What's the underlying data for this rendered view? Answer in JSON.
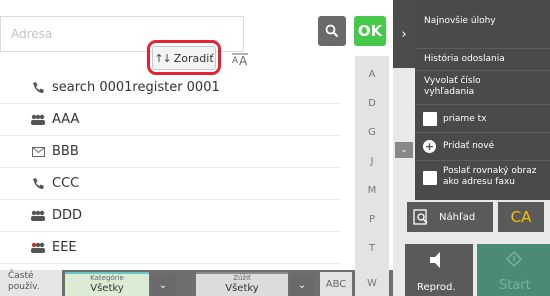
{
  "address": {
    "placeholder": "Adresa"
  },
  "toolbar": {
    "ok_label": "OK",
    "sort_label": "Zoradiť",
    "sort_icon": "sort-icon",
    "text_size_icon": "text-size-icon"
  },
  "contacts": [
    {
      "icon": "phone-icon",
      "name": "search 0001register 0001"
    },
    {
      "icon": "group-icon",
      "name": "AAA"
    },
    {
      "icon": "email-icon",
      "name": "BBB"
    },
    {
      "icon": "phone-icon",
      "name": "CCC"
    },
    {
      "icon": "group-icon",
      "name": "DDD"
    },
    {
      "icon": "group-multi-icon",
      "name": "EEE"
    }
  ],
  "index_letters": [
    "A",
    "D",
    "G",
    "J",
    "M",
    "P",
    "T",
    "W"
  ],
  "bottom": {
    "frequent_label": "Časté použív.",
    "category_caption": "Kategórie",
    "category_value": "Všetky",
    "filter_caption": "Zúžiť",
    "filter_value": "Všetky",
    "abc_label": "ABC"
  },
  "menu": {
    "latest_jobs": "Najnovšie úlohy",
    "send_history": "História odoslania",
    "call_search_number": "Vyvolať číslo vyhľadania",
    "direct_tx": "priame tx",
    "add_new": "Pridať nové",
    "send_same_as_fax": "Poslať rovnaký obraz ako adresu faxu"
  },
  "actions": {
    "preview": "Náhľad",
    "ca": "CA",
    "reprod": "Reprod.",
    "start": "Start"
  },
  "colors": {
    "ok_green": "#45c94b",
    "ca_yellow": "#f6c300",
    "highlight_red": "#e52231",
    "start_teal": "#4b8a74"
  }
}
